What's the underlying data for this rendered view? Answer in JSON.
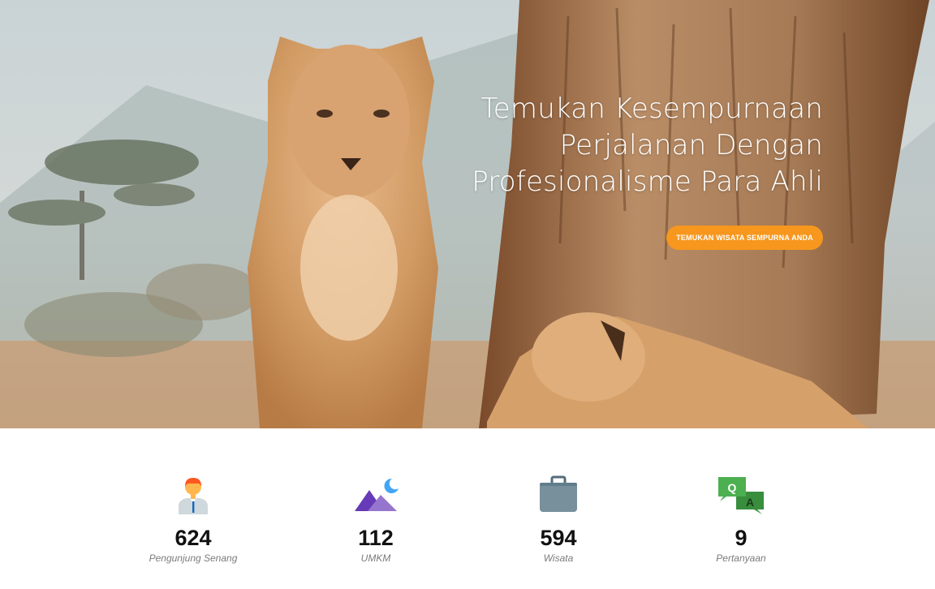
{
  "hero": {
    "title_lines": [
      "Temukan Kesempurnaan",
      "Perjalanan Dengan",
      "Profesionalisme Para Ahli"
    ],
    "cta_label": "TEMUKAN WISATA SEMPURNA ANDA",
    "accent_color": "#f7971e"
  },
  "stats": [
    {
      "icon": "visitor-person-icon",
      "value": "624",
      "label": "Pengunjung Senang"
    },
    {
      "icon": "mountains-moon-icon",
      "value": "112",
      "label": "UMKM"
    },
    {
      "icon": "suitcase-icon",
      "value": "594",
      "label": "Wisata"
    },
    {
      "icon": "qa-chat-icon",
      "value": "9",
      "label": "Pertanyaan"
    }
  ]
}
